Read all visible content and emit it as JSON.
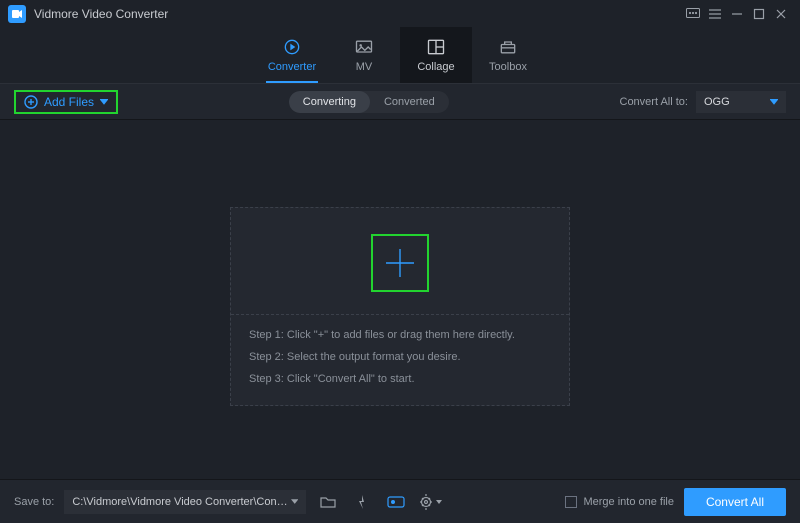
{
  "app": {
    "title": "Vidmore Video Converter"
  },
  "nav": {
    "tabs": [
      {
        "label": "Converter"
      },
      {
        "label": "MV"
      },
      {
        "label": "Collage"
      },
      {
        "label": "Toolbox"
      }
    ],
    "active_index": 0,
    "dark_index": 2
  },
  "toolbar": {
    "add_files_label": "Add Files",
    "segmented": {
      "converting": "Converting",
      "converted": "Converted",
      "active": "converting"
    },
    "convert_all_to_label": "Convert All to:",
    "format_selected": "OGG"
  },
  "droparea": {
    "steps": [
      "Step 1: Click \"+\" to add files or drag them here directly.",
      "Step 2: Select the output format you desire.",
      "Step 3: Click \"Convert All\" to start."
    ]
  },
  "footer": {
    "save_to_label": "Save to:",
    "save_path": "C:\\Vidmore\\Vidmore Video Converter\\Converted",
    "merge_label": "Merge into one file",
    "convert_all_button": "Convert All"
  }
}
